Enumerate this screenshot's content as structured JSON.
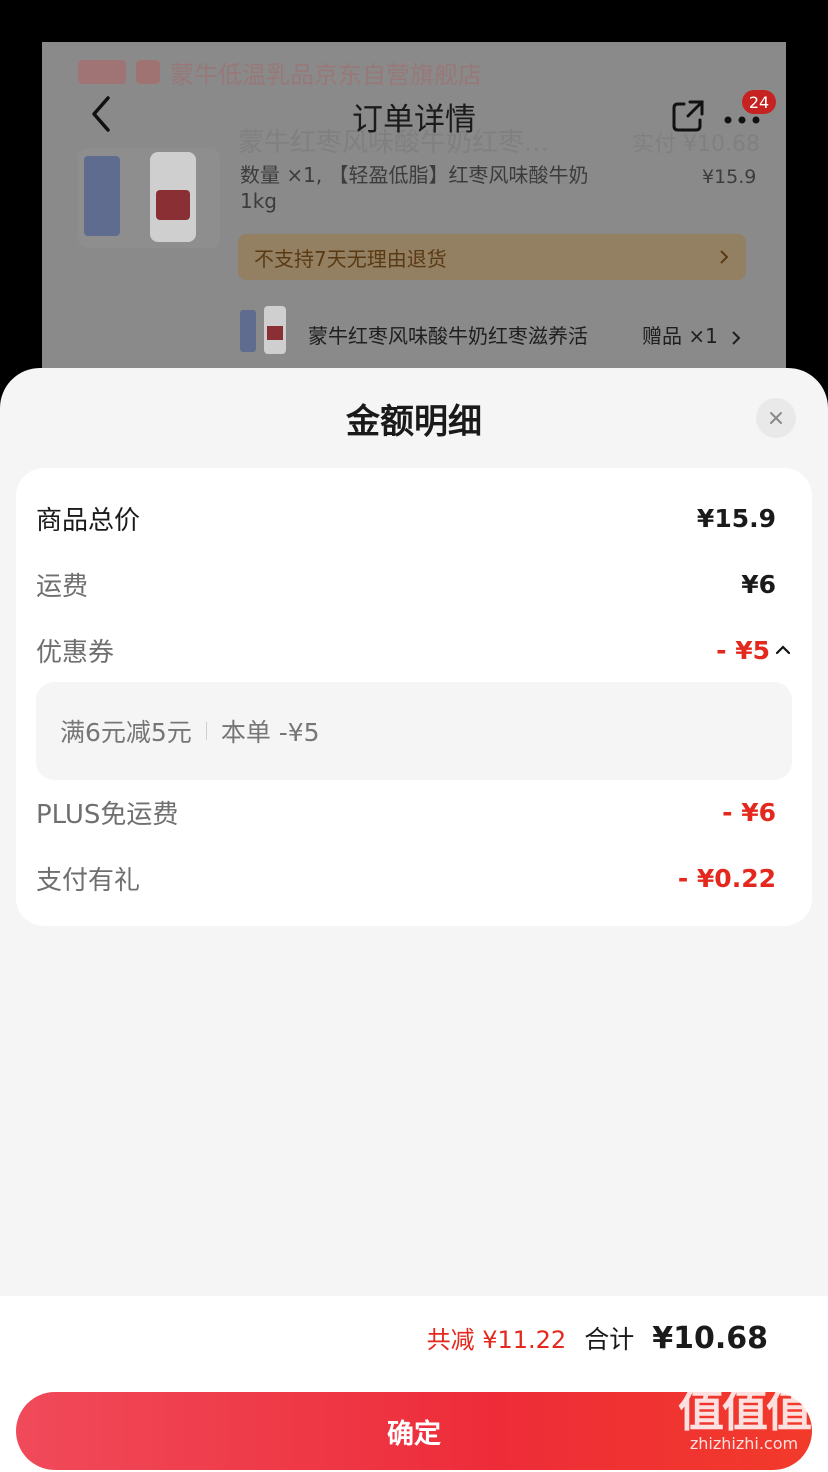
{
  "background_page": {
    "store_name": "蒙牛低温乳品京东自营旗舰店",
    "nav_title": "订单详情",
    "badge_count": "24",
    "ghost_product_title": "蒙牛红枣风味酸牛奶红枣...",
    "ghost_pay": "实付 ¥10.68",
    "product_qty_desc": "数量 ×1, 【轻盈低脂】红枣风味酸牛奶1kg",
    "product_price": "¥15.9",
    "no_return_notice": "不支持7天无理由退货",
    "gift_name": "蒙牛红枣风味酸牛奶红枣滋养活",
    "gift_qty": "赠品 ×1"
  },
  "sheet": {
    "title": "金额明细",
    "rows": {
      "goods_total_label": "商品总价",
      "goods_total_value": "¥15.9",
      "shipping_label": "运费",
      "shipping_value": "¥6",
      "coupon_label": "优惠券",
      "coupon_value": "- ¥5",
      "coupon_rule": "满6元减5元",
      "coupon_applied": "本单 -¥5",
      "plus_label": "PLUS免运费",
      "plus_value": "- ¥6",
      "pay_gift_label": "支付有礼",
      "pay_gift_value": "- ¥0.22"
    }
  },
  "footer": {
    "total_discount": "共减 ¥11.22",
    "total_label": "合计",
    "total_value": "¥10.68",
    "confirm_label": "确定"
  },
  "watermark": {
    "logo_text": "值值值",
    "url": "zhizhizhi.com"
  },
  "colors": {
    "accent_red": "#e4281e",
    "button_red": "#ee2c39",
    "sheet_bg": "#f5f5f5"
  }
}
